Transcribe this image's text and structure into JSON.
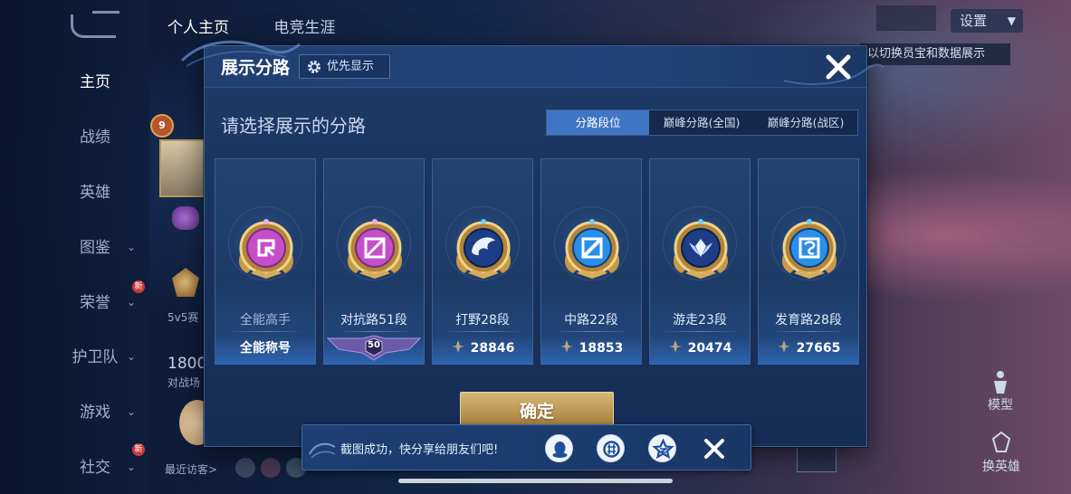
{
  "background": {
    "nav": [
      {
        "label": "主页",
        "active": true
      },
      {
        "label": "战绩"
      },
      {
        "label": "英雄"
      },
      {
        "label": "图鉴"
      },
      {
        "label": "荣誉"
      },
      {
        "label": "护卫队"
      },
      {
        "label": "游戏"
      },
      {
        "label": "社交"
      }
    ],
    "top_tabs": [
      "个人主页",
      "电竞生涯"
    ],
    "settings_label": "设置",
    "hint_banner": "以切换员宝和数据展示",
    "badge_level": "9",
    "mode_label": "5v5赛",
    "score_text": "1800",
    "score_sub": "对战场",
    "recent_visitors": "最近访客>",
    "new_badge": "新",
    "model_label": "模型",
    "swap_hero_label": "换英雄"
  },
  "modal": {
    "title": "展示分路",
    "priority_button": "优先显示",
    "subtitle": "请选择展示的分路",
    "tabs": [
      {
        "label": "分路段位",
        "active": true
      },
      {
        "label": "巅峰分路(全国)",
        "active": false
      },
      {
        "label": "巅峰分路(战区)",
        "active": false
      }
    ],
    "cards": [
      {
        "name": "全能高手",
        "footer": "全能称号",
        "dim": true,
        "gem": "#d04fd0"
      },
      {
        "name": "对抗路51段",
        "footer": "50",
        "dim": false,
        "gem": "#d04fd0"
      },
      {
        "name": "打野28段",
        "footer": "28846",
        "dim": false,
        "gem": "#2e7fe0"
      },
      {
        "name": "中路22段",
        "footer": "18853",
        "dim": false,
        "gem": "#2e7fe0"
      },
      {
        "name": "游走23段",
        "footer": "20474",
        "dim": false,
        "gem": "#2e7fe0"
      },
      {
        "name": "发育路28段",
        "footer": "27665",
        "dim": false,
        "gem": "#2e7fe0"
      }
    ],
    "confirm_button": "确定"
  },
  "toast": {
    "message": "截图成功，快分享给朋友们吧!",
    "share_targets": [
      "qq-icon",
      "wechat-icon",
      "qzone-icon"
    ]
  },
  "colors": {
    "accent_blue": "#3f75c2",
    "gold": "#c9a661",
    "panel": "#1a3460"
  }
}
